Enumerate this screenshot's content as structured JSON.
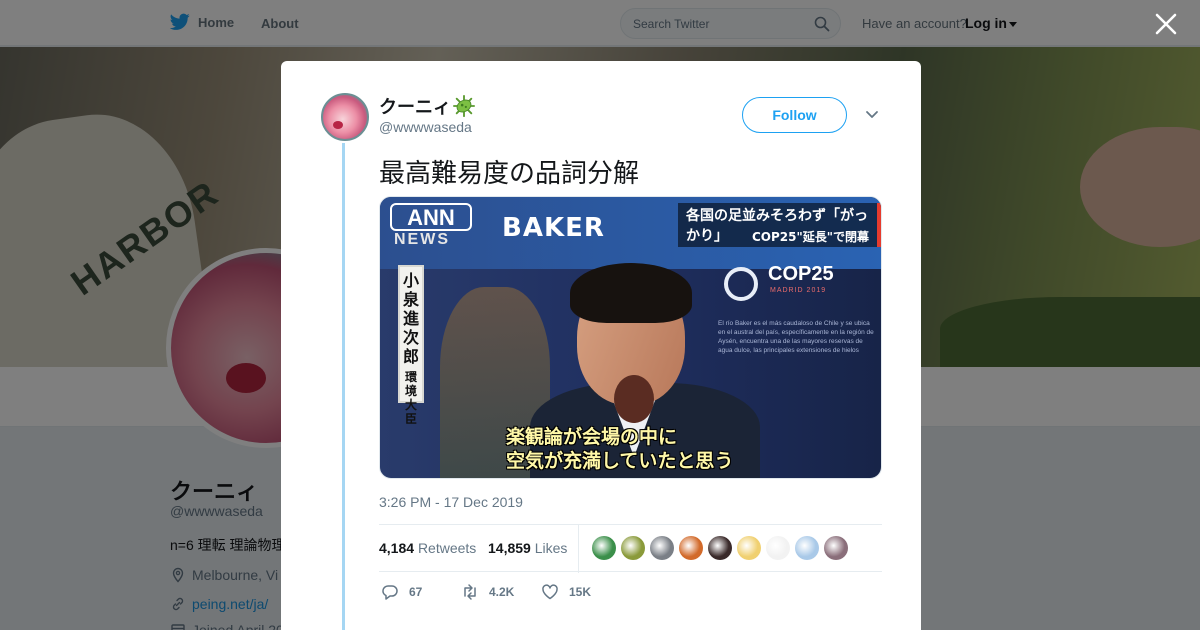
{
  "topbar": {
    "home_label": "Home",
    "about_label": "About",
    "search_placeholder": "Search Twitter",
    "account_question": "Have an account?",
    "login_label": "Log in"
  },
  "profile": {
    "name": "クーニィ",
    "handle": "@wwwwaseda",
    "bio": "n=6 理転 理論物理",
    "location": "Melbourne, Vi",
    "link": "peing.net/ja/",
    "joined": "Joined April 20"
  },
  "banner": {
    "shirt_text": "HARBOR"
  },
  "tweet": {
    "author_name": "クーニィ",
    "author_handle": "@wwwwaseda",
    "follow_label": "Follow",
    "text": "最高難易度の品詞分解",
    "timestamp": "3:26 PM - 17 Dec 2019",
    "retweets_count": "4,184",
    "retweets_label": "Retweets",
    "likes_count": "14,859",
    "likes_label": "Likes",
    "reply_count": "67",
    "retweet_action_count": "4.2K",
    "like_action_count": "15K",
    "liker_colors": [
      "#3b8f4a",
      "#8a9a3a",
      "#7a7f86",
      "#d26a2a",
      "#3a2a2a",
      "#f0d070",
      "#f2f2f2",
      "#a9c9e8",
      "#8a6e7a"
    ]
  },
  "media": {
    "ann_logo": "ANN",
    "news_label": "NEWS",
    "baker_sign": "BAKER",
    "headline_main": "各国の足並みそろわず「がっかり」",
    "headline_sub": "COP25\"延長\"で閉幕",
    "cop_title": "COP25",
    "cop_sub": "MADRID 2019",
    "sign_text": "El río Baker es el más caudaloso de Chile y se ubica en el austral del país, específicamente en la región de Aysén, encuentra una de las mayores reservas de agua dulce, las principales extensiones de hielos",
    "speaker_name": "小泉進次郎",
    "speaker_title": "環境大臣",
    "subtitle_line1": "楽観論が会場の中に",
    "subtitle_line2": "空気が充満していたと思う"
  },
  "colors": {
    "accent": "#1da1f2",
    "thread_line": "#a5d6f3",
    "text_secondary": "#657786"
  }
}
